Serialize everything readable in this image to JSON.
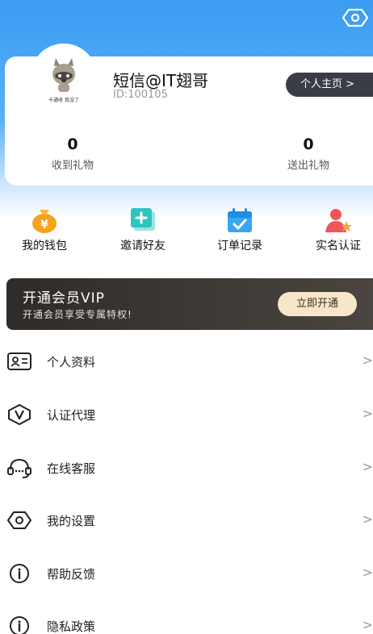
{
  "header": {
    "settings_icon": "eye-hexagon-icon"
  },
  "profile": {
    "username": "短信@IT翅哥",
    "user_id": "ID:100105",
    "homepage_label": "个人主页 >",
    "avatar_text": "卡通收  我没了"
  },
  "stats": {
    "received": {
      "value": "0",
      "label": "收到礼物"
    },
    "sent": {
      "value": "0",
      "label": "送出礼物"
    }
  },
  "quick_actions": [
    {
      "label": "我的钱包",
      "icon": "money-bag-icon"
    },
    {
      "label": "邀请好友",
      "icon": "invite-icon"
    },
    {
      "label": "订单记录",
      "icon": "calendar-check-icon"
    },
    {
      "label": "实名认证",
      "icon": "user-star-icon"
    }
  ],
  "vip": {
    "title": "开通会员VIP",
    "subtitle": "开通会员享受专属特权!",
    "button": "立即开通"
  },
  "menu": [
    {
      "label": "个人资料",
      "icon": "id-card-icon"
    },
    {
      "label": "认证代理",
      "icon": "v-shield-icon"
    },
    {
      "label": "在线客服",
      "icon": "headset-icon"
    },
    {
      "label": "我的设置",
      "icon": "eye-hexagon-icon"
    },
    {
      "label": "帮助反馈",
      "icon": "info-icon"
    },
    {
      "label": "隐私政策",
      "icon": "info-icon"
    }
  ],
  "chevron": ">",
  "colors": {
    "header_blue": "#3b9cf2",
    "dark_button": "#3a3d44",
    "vip_gold": "#f6e7c8",
    "wallet_orange": "#f4a21c",
    "invite_teal": "#2cc6c2",
    "orders_blue": "#3aa6f2",
    "verify_red": "#f0555a"
  }
}
